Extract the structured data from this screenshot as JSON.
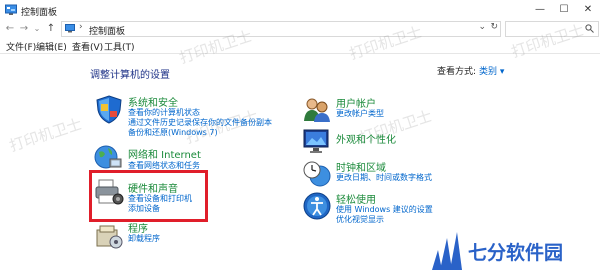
{
  "window": {
    "title": "控制面板",
    "minimize": "—",
    "maximize": "☐",
    "close": "✕"
  },
  "nav": {
    "back": "←",
    "forward": "→",
    "dropdown": "⌄",
    "up": "↑"
  },
  "address": {
    "separator": "›",
    "path": "控制面板",
    "dropdown": "⌄",
    "refresh": "↻"
  },
  "menu": [
    "文件(F)",
    "编辑(E)",
    "查看(V)",
    "工具(T)"
  ],
  "page": {
    "heading": "调整计算机的设置",
    "view_by_label": "查看方式:",
    "view_by_value": "类别 ▾"
  },
  "categories_left": [
    {
      "title": "系统和安全",
      "links": [
        "查看你的计算机状态",
        "通过文件历史记录保存你的文件备份副本",
        "备份和还原(Windows 7)"
      ]
    },
    {
      "title": "网络和 Internet",
      "links": [
        "查看网络状态和任务"
      ]
    },
    {
      "title": "硬件和声音",
      "links": [
        "查看设备和打印机",
        "添加设备"
      ]
    },
    {
      "title": "程序",
      "links": [
        "卸载程序"
      ]
    }
  ],
  "categories_right": [
    {
      "title": "用户帐户",
      "links": [
        "更改帐户类型"
      ]
    },
    {
      "title": "外观和个性化",
      "links": []
    },
    {
      "title": "时钟和区域",
      "links": [
        "更改日期、时间或数字格式"
      ]
    },
    {
      "title": "轻松使用",
      "links": [
        "使用 Windows 建议的设置",
        "优化视觉显示"
      ]
    }
  ],
  "watermarks": [
    "打印机卫士",
    "打印机卫士",
    "打印机卫士",
    "打印机卫士",
    "打印机卫士",
    "打印机卫士"
  ],
  "brand": {
    "name": "七分软件园"
  },
  "colors": {
    "link": "#0066cc",
    "category_title": "#1a8a3a",
    "heading": "#1e3287",
    "highlight": "#e01e2a",
    "brand": "#2a62c8"
  }
}
